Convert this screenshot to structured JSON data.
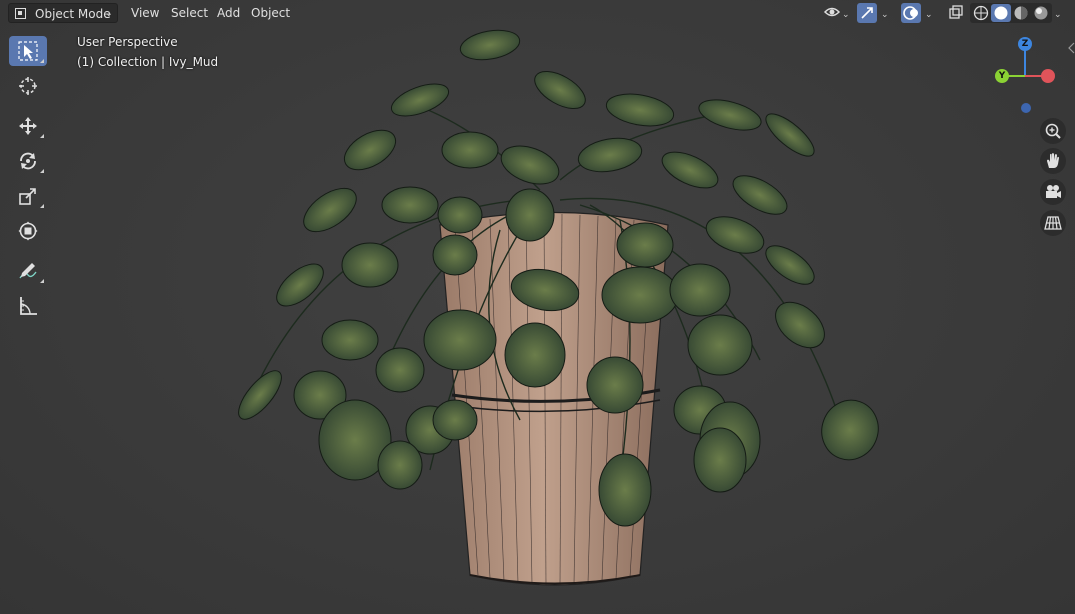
{
  "header": {
    "mode_label": "Object Mode",
    "menus": [
      "View",
      "Select",
      "Add",
      "Object"
    ]
  },
  "overlay": {
    "view_name": "User Perspective",
    "collection_info": "(1) Collection | Ivy_Mud"
  },
  "gizmo": {
    "z_label": "Z",
    "y_label": "Y",
    "x_label": "X"
  },
  "toolbar": {
    "tools": [
      "select-box",
      "cursor",
      "move",
      "rotate",
      "scale",
      "transform",
      "annotate",
      "measure"
    ],
    "active": "select-box"
  },
  "navigation": [
    "zoom",
    "pan",
    "camera-view",
    "perspective-toggle"
  ],
  "colors": {
    "background": "#3b3b3b",
    "active_tool": "#5a78b0",
    "axis_x": "#e0545a",
    "axis_y": "#8bd234",
    "axis_z": "#3d86e0"
  }
}
